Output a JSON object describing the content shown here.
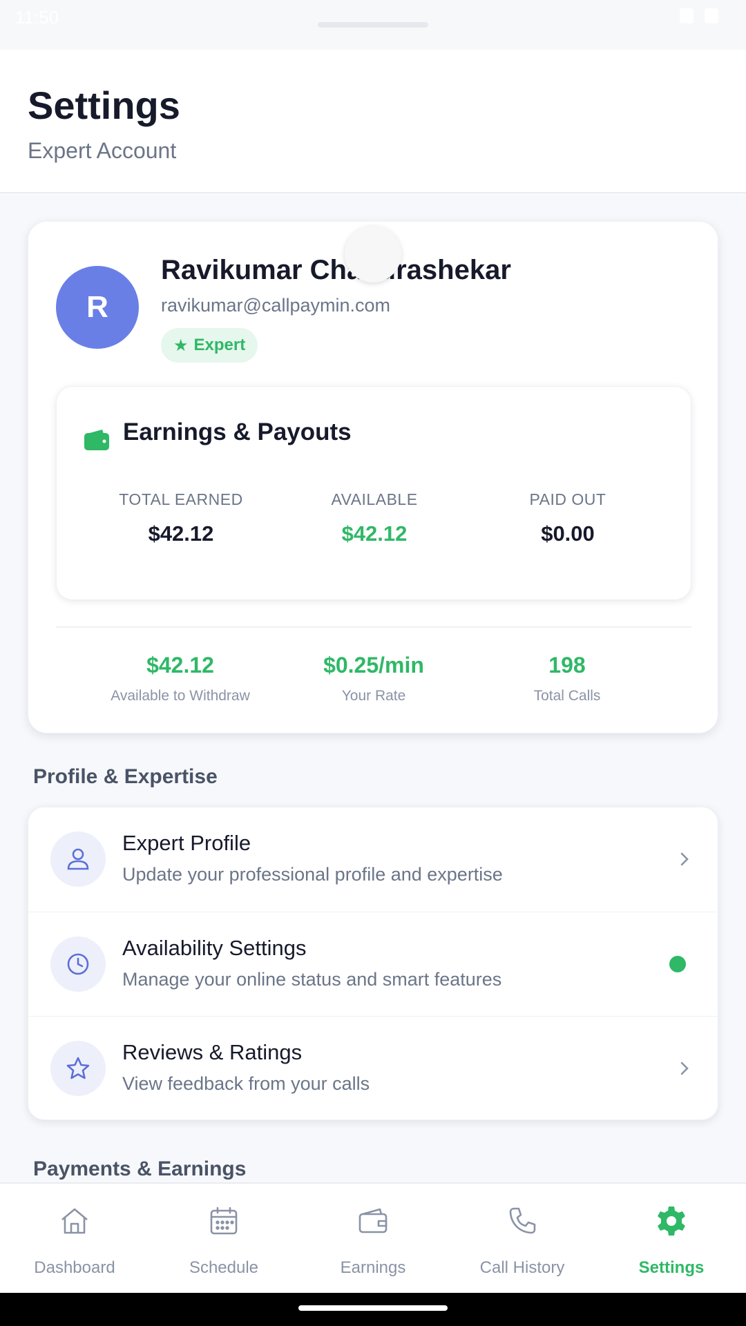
{
  "status_bar": {
    "time": "11:50"
  },
  "header": {
    "title": "Settings",
    "subtitle": "Expert Account"
  },
  "profile": {
    "avatar_initial": "R",
    "name": "Ravikumar Chandrashekar",
    "email": "ravikumar@callpaymin.com",
    "badge": "Expert"
  },
  "earnings": {
    "title": "Earnings & Payouts",
    "items": [
      {
        "label": "TOTAL EARNED",
        "value": "$42.12"
      },
      {
        "label": "AVAILABLE",
        "value": "$42.12"
      },
      {
        "label": "PAID OUT",
        "value": "$0.00"
      }
    ]
  },
  "stats": [
    {
      "value": "$42.12",
      "label": "Available to Withdraw"
    },
    {
      "value": "$0.25/min",
      "label": "Your Rate"
    },
    {
      "value": "198",
      "label": "Total Calls"
    }
  ],
  "sections": {
    "profile_expertise": "Profile & Expertise",
    "payments_earnings": "Payments & Earnings"
  },
  "settings_items": [
    {
      "title": "Expert Profile",
      "description": "Update your professional profile and expertise",
      "icon": "user-icon"
    },
    {
      "title": "Availability Settings",
      "description": "Manage your online status and smart features",
      "icon": "clock-icon"
    },
    {
      "title": "Reviews & Ratings",
      "description": "View feedback from your calls",
      "icon": "star-icon"
    }
  ],
  "nav": [
    {
      "label": "Dashboard",
      "icon": "home-icon"
    },
    {
      "label": "Schedule",
      "icon": "calendar-icon"
    },
    {
      "label": "Earnings",
      "icon": "wallet-icon"
    },
    {
      "label": "Call History",
      "icon": "phone-icon"
    },
    {
      "label": "Settings",
      "icon": "gear-icon",
      "active": true
    }
  ],
  "colors": {
    "accent_green": "#2fb866",
    "avatar_blue": "#6a7fe6",
    "icon_blue": "#5b6fd6"
  }
}
